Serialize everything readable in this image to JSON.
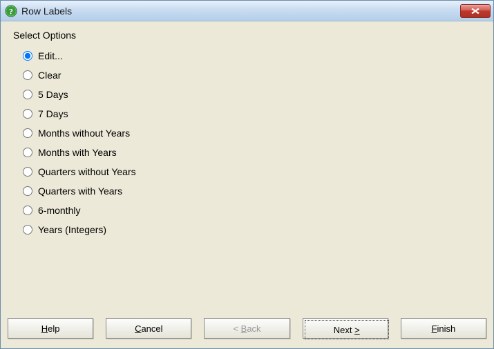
{
  "titlebar": {
    "title": "Row Labels",
    "icon": "help-icon",
    "close": "close-icon"
  },
  "content": {
    "section_label": "Select Options",
    "options": [
      {
        "label": "Edit...",
        "checked": true
      },
      {
        "label": "Clear",
        "checked": false
      },
      {
        "label": "5 Days",
        "checked": false
      },
      {
        "label": "7 Days",
        "checked": false
      },
      {
        "label": "Months without Years",
        "checked": false
      },
      {
        "label": "Months with Years",
        "checked": false
      },
      {
        "label": "Quarters without Years",
        "checked": false
      },
      {
        "label": "Quarters with Years",
        "checked": false
      },
      {
        "label": "6-monthly",
        "checked": false
      },
      {
        "label": "Years (Integers)",
        "checked": false
      }
    ]
  },
  "buttons": {
    "help": {
      "pre": "",
      "u": "H",
      "post": "elp"
    },
    "cancel": {
      "pre": "",
      "u": "C",
      "post": "ancel"
    },
    "back": {
      "pre": "< ",
      "u": "B",
      "post": "ack",
      "disabled": true
    },
    "next": {
      "pre": "Next ",
      "u": ">",
      "post": ""
    },
    "finish": {
      "pre": "",
      "u": "F",
      "post": "inish"
    }
  }
}
